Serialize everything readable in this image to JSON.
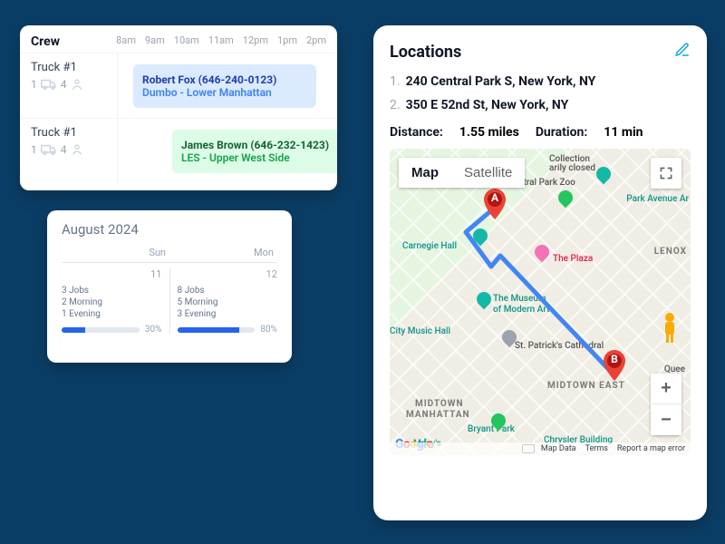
{
  "crew": {
    "title": "Crew",
    "time_slots": [
      "8am",
      "9am",
      "10am",
      "11am",
      "12pm",
      "1pm",
      "2pm"
    ],
    "rows": [
      {
        "truck": "Truck #1",
        "icons_left": "1",
        "icons_right": "4",
        "event": {
          "name": "Robert Fox (646-240-0123)",
          "route": "Dumbo - Lower Manhattan",
          "color": "blue"
        }
      },
      {
        "truck": "Truck #1",
        "icons_left": "1",
        "icons_right": "4",
        "event": {
          "name": "James Brown (646-232-1423)",
          "route": "LES - Upper West Side",
          "color": "green"
        }
      }
    ]
  },
  "calendar": {
    "title": "August 2024",
    "day_headers": [
      "Sun",
      "Mon"
    ],
    "cells": [
      {
        "date": "11",
        "jobs": "3 Jobs",
        "morning": "2 Morning",
        "evening": "1 Evening",
        "pct": "30%",
        "pct_width": 30
      },
      {
        "date": "12",
        "jobs": "8 Jobs",
        "morning": "5 Morning",
        "evening": "3 Evening",
        "pct": "80%",
        "pct_width": 80
      }
    ]
  },
  "locations": {
    "title": "Locations",
    "items": [
      {
        "num": "1.",
        "addr": "240 Central Park S, New York, NY"
      },
      {
        "num": "2.",
        "addr": "350 E 52nd St, New York, NY"
      }
    ],
    "distance_label": "Distance:",
    "distance_value": "1.55 miles",
    "duration_label": "Duration:",
    "duration_value": "11 min",
    "map": {
      "map_label": "Map",
      "satellite_label": "Satellite",
      "zoom_in": "+",
      "zoom_out": "−",
      "footer": {
        "data": "Map Data",
        "terms": "Terms",
        "report": "Report a map error"
      },
      "pins": [
        "A",
        "B"
      ],
      "poi": {
        "central_park_zoo": "Central Park Zoo",
        "collection": "Collection",
        "closed": "arily closed",
        "park_ave": "Park Avenue Ar",
        "carnegie": "Carnegie Hall",
        "plaza": "The Plaza",
        "lenox": "LENOX",
        "museum1": "The Museum",
        "museum2": "of Modern Art",
        "radio": "City Music Hall",
        "stpat": "St. Patrick's Cathedral",
        "midtown_east": "MIDTOWN EAST",
        "midtown_man1": "MIDTOWN",
        "midtown_man2": "MANHATTAN",
        "bryant": "Bryant Park",
        "chrysler": "Chrysler Building",
        "macys": "Macy's",
        "queensboro": "Quee"
      }
    }
  }
}
